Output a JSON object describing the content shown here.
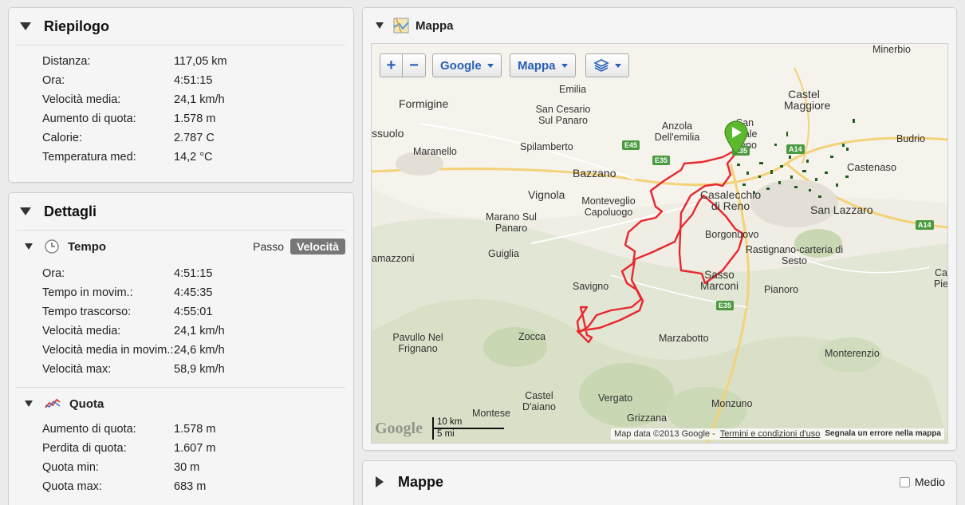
{
  "summary": {
    "title": "Riepilogo",
    "rows": [
      {
        "label": "Distanza:",
        "value": "117,05 km"
      },
      {
        "label": "Ora:",
        "value": "4:51:15"
      },
      {
        "label": "Velocità media:",
        "value": "24,1 km/h"
      },
      {
        "label": "Aumento di quota:",
        "value": "1.578 m"
      },
      {
        "label": "Calorie:",
        "value": "2.787 C"
      },
      {
        "label": "Temperatura med:",
        "value": "14,2 °C"
      }
    ]
  },
  "details": {
    "title": "Dettagli",
    "time": {
      "title": "Tempo",
      "toggle": {
        "pace": "Passo",
        "speed": "Velocità"
      },
      "rows": [
        {
          "label": "Ora:",
          "value": "4:51:15"
        },
        {
          "label": "Tempo in movim.:",
          "value": "4:45:35"
        },
        {
          "label": "Tempo trascorso:",
          "value": "4:55:01"
        },
        {
          "label": "Velocità media:",
          "value": "24,1 km/h"
        },
        {
          "label": "Velocità media in movim.:",
          "value": "24,6 km/h"
        },
        {
          "label": "Velocità max:",
          "value": "58,9 km/h"
        }
      ]
    },
    "elevation": {
      "title": "Quota",
      "rows": [
        {
          "label": "Aumento di quota:",
          "value": "1.578 m"
        },
        {
          "label": "Perdita di quota:",
          "value": "1.607 m"
        },
        {
          "label": "Quota min:",
          "value": "30 m"
        },
        {
          "label": "Quota max:",
          "value": "683 m"
        }
      ]
    }
  },
  "map_panel": {
    "title": "Mappa",
    "controls": {
      "zoom_in": "+",
      "zoom_out": "−",
      "provider": "Google",
      "type": "Mappa"
    },
    "places": [
      "Minerbio",
      "Castel Maggiore",
      "Emilia",
      "Formigine",
      "San Cesario Sul Panaro",
      "Anzola Dell'emilia",
      "San Vitale Reno",
      "Budrio",
      "ssuolo",
      "Maranello",
      "Spilamberto",
      "Castenaso",
      "Bazzano",
      "Casalecchio di Reno",
      "Vignola",
      "Monteveglio Capoluogo",
      "San Lazzaro",
      "Marano Sul Panaro",
      "Borgonuovo",
      "amazzoni",
      "Guiglia",
      "Rastignano-carteria di Sesto",
      "Sasso Marconi",
      "Ca Pie",
      "Savigno",
      "Pianoro",
      "Pavullo Nel Frignano",
      "Zocca",
      "Marzabotto",
      "Monterenzio",
      "Castel D'aiano",
      "Vergato",
      "Monzuno",
      "Montese",
      "Grizzana"
    ],
    "roads": [
      "E45",
      "E35",
      "A14",
      "A14",
      "E35",
      "E35"
    ],
    "scale": {
      "km": "10 km",
      "mi": "5 mi"
    },
    "logo": "Google",
    "attribution": {
      "data": "Map data ©2013 Google -",
      "terms": "Termini e condizioni d'uso",
      "report": "Segnala un errore nella mappa"
    }
  },
  "maps_panel": {
    "title": "Mappe",
    "checkbox_label": "Medio"
  },
  "colors": {
    "route": "#e8282f",
    "start_marker": "#5cb82d",
    "link": "#2a60b8"
  }
}
